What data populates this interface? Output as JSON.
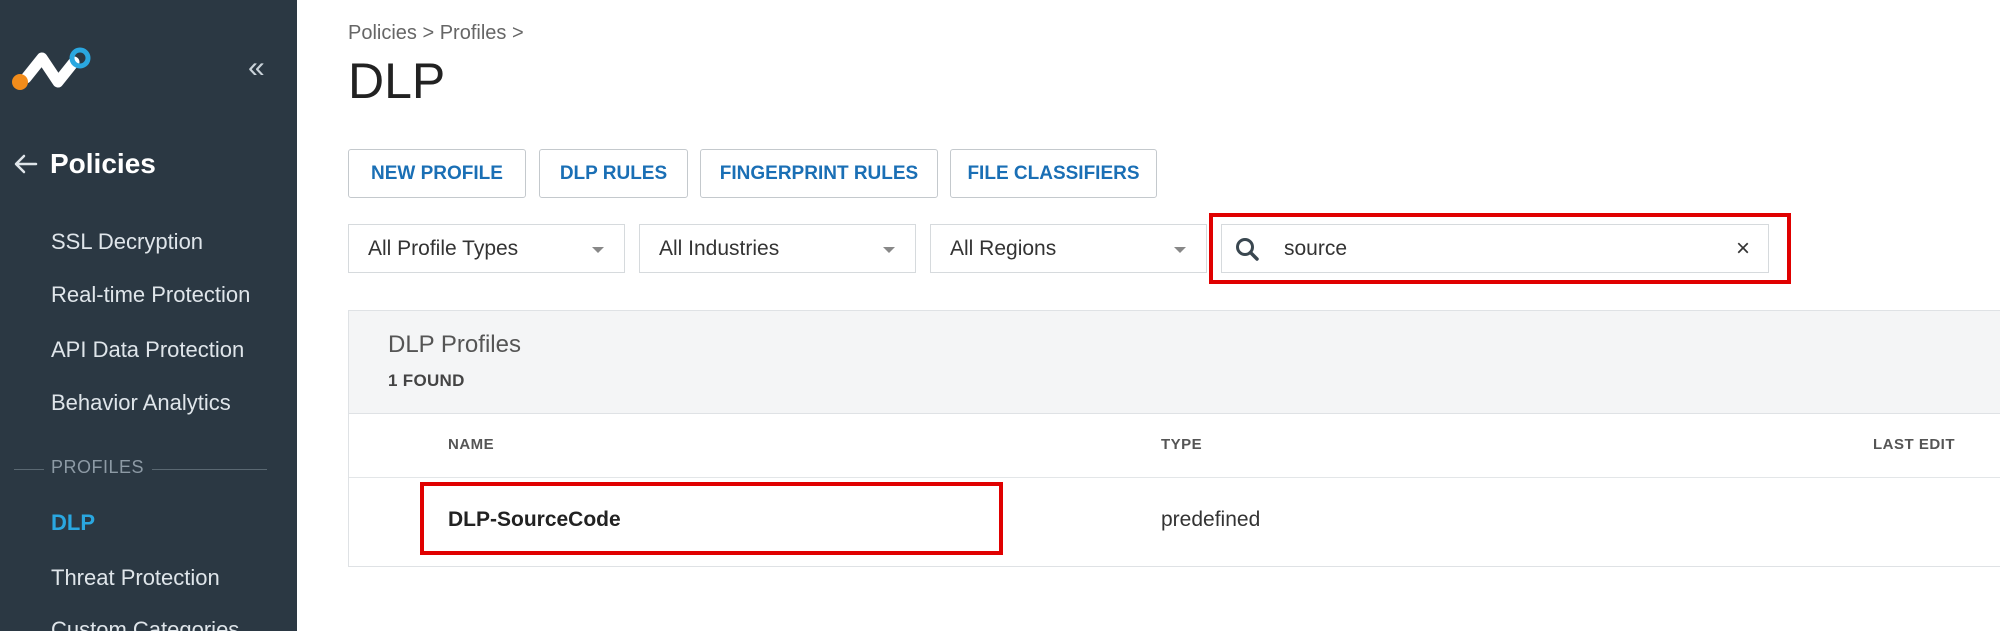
{
  "sidebar": {
    "back_title": "Policies",
    "nav_items": [
      {
        "label": "SSL Decryption"
      },
      {
        "label": "Real-time Protection"
      },
      {
        "label": "API Data Protection"
      },
      {
        "label": "Behavior Analytics"
      }
    ],
    "section_label": "PROFILES",
    "profile_items": [
      {
        "label": "DLP",
        "active": true
      },
      {
        "label": "Threat Protection"
      },
      {
        "label": "Custom Categories"
      }
    ],
    "colors": {
      "background": "#2b3843",
      "active": "#2aa7e0"
    }
  },
  "header": {
    "breadcrumb": "Policies > Profiles >",
    "title": "DLP"
  },
  "toolbar": {
    "buttons": [
      "NEW PROFILE",
      "DLP RULES",
      "FINGERPRINT RULES",
      "FILE CLASSIFIERS"
    ]
  },
  "filters": {
    "profile_type": "All Profile Types",
    "industry": "All Industries",
    "region": "All Regions",
    "search_value": "source",
    "clear_label": "×"
  },
  "panel": {
    "title": "DLP Profiles",
    "count": "1 FOUND",
    "columns": [
      "NAME",
      "TYPE",
      "LAST EDIT"
    ],
    "rows": [
      {
        "name": "DLP-SourceCode",
        "type": "predefined",
        "last_edit": ""
      }
    ]
  },
  "highlight_color": "#e00000"
}
